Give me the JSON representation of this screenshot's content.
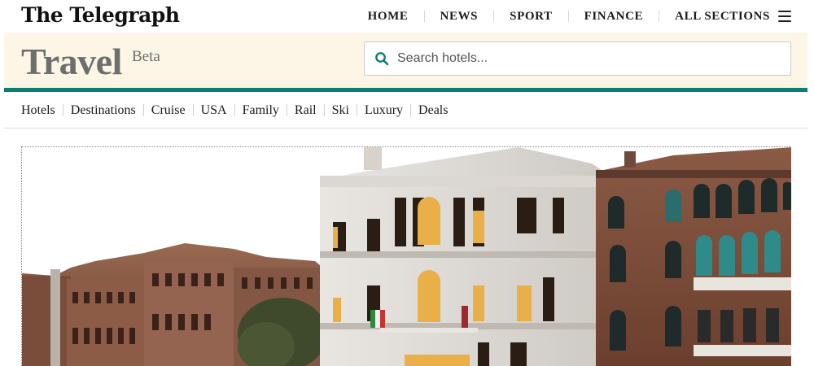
{
  "header": {
    "logo_text": "The Telegraph",
    "nav": [
      "HOME",
      "NEWS",
      "SPORT",
      "FINANCE",
      "ALL SECTIONS"
    ],
    "menu_icon": "hamburger-menu-icon"
  },
  "travel": {
    "title": "Travel",
    "badge": "Beta",
    "search_placeholder": "Search hotels...",
    "search_value": "",
    "search_icon": "search-icon"
  },
  "sections": [
    "Hotels",
    "Destinations",
    "Cruise",
    "USA",
    "Family",
    "Rail",
    "Ski",
    "Luxury",
    "Deals"
  ],
  "colors": {
    "band_background": "#fdf6e6",
    "accent_teal": "#0d7d74",
    "travel_title_gray": "#6e6e6e"
  }
}
